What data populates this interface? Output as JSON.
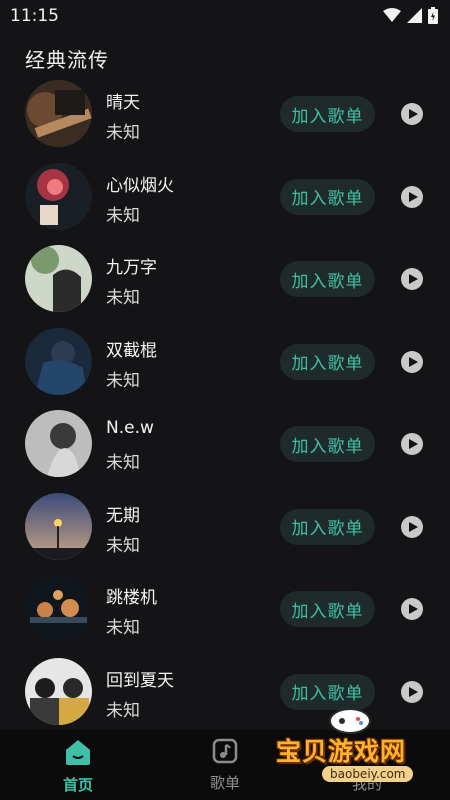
{
  "status_bar": {
    "time": "11:15"
  },
  "section": {
    "title": "经典流传"
  },
  "songs": [
    {
      "title": "晴天",
      "artist": "未知",
      "add_label": "加入歌单"
    },
    {
      "title": "心似烟火",
      "artist": "未知",
      "add_label": "加入歌单"
    },
    {
      "title": "九万字",
      "artist": "未知",
      "add_label": "加入歌单"
    },
    {
      "title": "双截棍",
      "artist": "未知",
      "add_label": "加入歌单"
    },
    {
      "title": "N.e.w",
      "artist": "未知",
      "add_label": "加入歌单"
    },
    {
      "title": "无期",
      "artist": "未知",
      "add_label": "加入歌单"
    },
    {
      "title": "跳楼机",
      "artist": "未知",
      "add_label": "加入歌单"
    },
    {
      "title": "回到夏天",
      "artist": "未知",
      "add_label": "加入歌单"
    }
  ],
  "tabbar": {
    "home_label": "首页",
    "songs_label": "歌单",
    "mine_label": "我的"
  },
  "watermark": {
    "text": "宝贝游戏网",
    "sub": "baobeiy.com"
  },
  "colors": {
    "accent": "#3fc0a6",
    "background": "#141416",
    "button_bg": "#1f2b2a"
  }
}
